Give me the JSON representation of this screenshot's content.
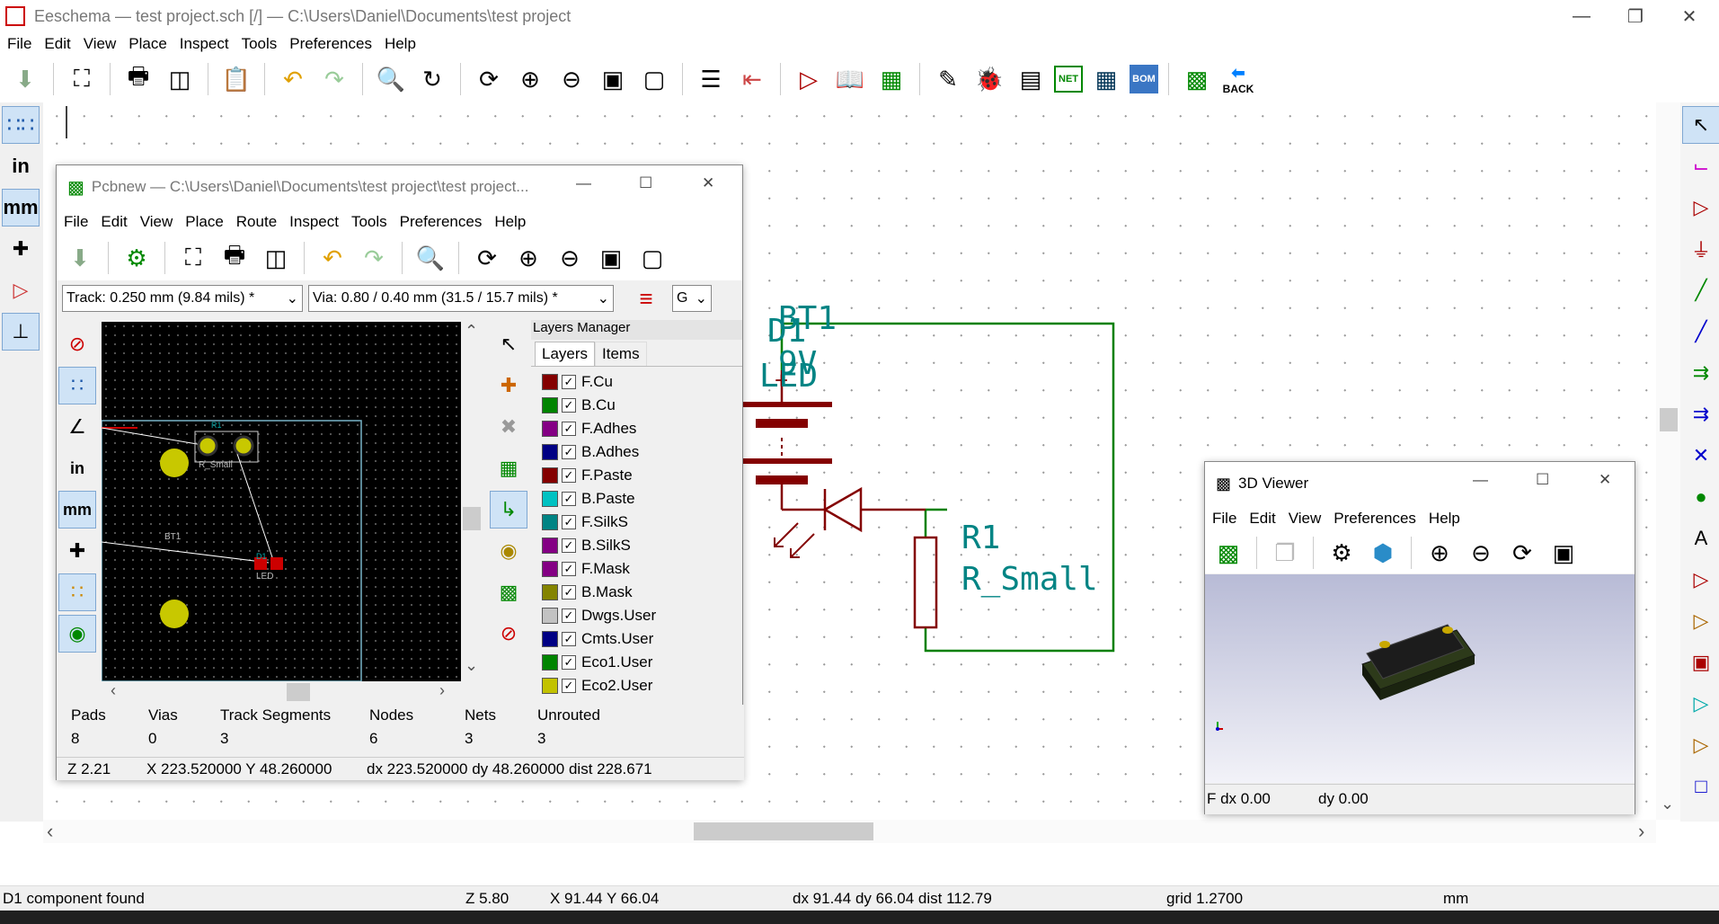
{
  "app": {
    "title": "Eeschema — test project.sch [/] — C:\\Users\\Daniel\\Documents\\test project",
    "menu": [
      "File",
      "Edit",
      "View",
      "Place",
      "Inspect",
      "Tools",
      "Preferences",
      "Help"
    ]
  },
  "toolbar": {
    "back_label": "BACK",
    "net_label": "NET",
    "bom_label": "BOM"
  },
  "left_toolbar": {
    "in_label": "in",
    "mm_label": "mm"
  },
  "schematic": {
    "bt1_ref": "BT1",
    "bt1_value": "9V",
    "d1_ref": "D1",
    "d1_value": "LED",
    "r1_ref": "R1",
    "r1_value": "R_Small",
    "wire_color": "#008000",
    "symbol_color": "#840000",
    "text_color": "#008484"
  },
  "status": {
    "message": "D1 component found",
    "zoom": "Z 5.80",
    "pos": "X 91.44  Y 66.04",
    "delta": "dx 91.44  dy 66.04  dist 112.79",
    "grid": "grid 1.2700",
    "units": "mm"
  },
  "pcbnew": {
    "title": "Pcbnew — C:\\Users\\Daniel\\Documents\\test project\\test project...",
    "menu": [
      "File",
      "Edit",
      "View",
      "Place",
      "Route",
      "Inspect",
      "Tools",
      "Preferences",
      "Help"
    ],
    "track_select": "Track: 0.250 mm (9.84 mils) *",
    "via_select": "Via: 0.80 / 0.40 mm (31.5 / 15.7 mils) *",
    "grid_select": "G",
    "in_label": "in",
    "mm_label": "mm",
    "board_labels": {
      "r1": "R1",
      "r_small": "R_Small",
      "bt1": "BT1",
      "d1": "D1",
      "led": "LED"
    },
    "layers_manager": {
      "title": "Layers Manager",
      "tabs": [
        "Layers",
        "Items"
      ],
      "layers": [
        {
          "name": "F.Cu",
          "color": "#840000"
        },
        {
          "name": "B.Cu",
          "color": "#008400"
        },
        {
          "name": "F.Adhes",
          "color": "#840084"
        },
        {
          "name": "B.Adhes",
          "color": "#000084"
        },
        {
          "name": "F.Paste",
          "color": "#840000"
        },
        {
          "name": "B.Paste",
          "color": "#00c2c2"
        },
        {
          "name": "F.SilkS",
          "color": "#008484"
        },
        {
          "name": "B.SilkS",
          "color": "#840084"
        },
        {
          "name": "F.Mask",
          "color": "#840084"
        },
        {
          "name": "B.Mask",
          "color": "#848400"
        },
        {
          "name": "Dwgs.User",
          "color": "#c2c2c2"
        },
        {
          "name": "Cmts.User",
          "color": "#000084"
        },
        {
          "name": "Eco1.User",
          "color": "#008400"
        },
        {
          "name": "Eco2.User",
          "color": "#c2c200"
        }
      ]
    },
    "stats": {
      "headers": [
        "Pads",
        "Vias",
        "Track Segments",
        "Nodes",
        "Nets",
        "Unrouted"
      ],
      "values": [
        "8",
        "0",
        "3",
        "6",
        "3",
        "3"
      ]
    },
    "status": {
      "zoom": "Z 2.21",
      "pos": "X 223.520000  Y 48.260000",
      "delta": "dx 223.520000  dy 48.260000  dist 228.671"
    }
  },
  "viewer3d": {
    "title": "3D Viewer",
    "menu": [
      "File",
      "Edit",
      "View",
      "Preferences",
      "Help"
    ],
    "status_dx": "F dx 0.00",
    "status_dy": "dy 0.00"
  }
}
